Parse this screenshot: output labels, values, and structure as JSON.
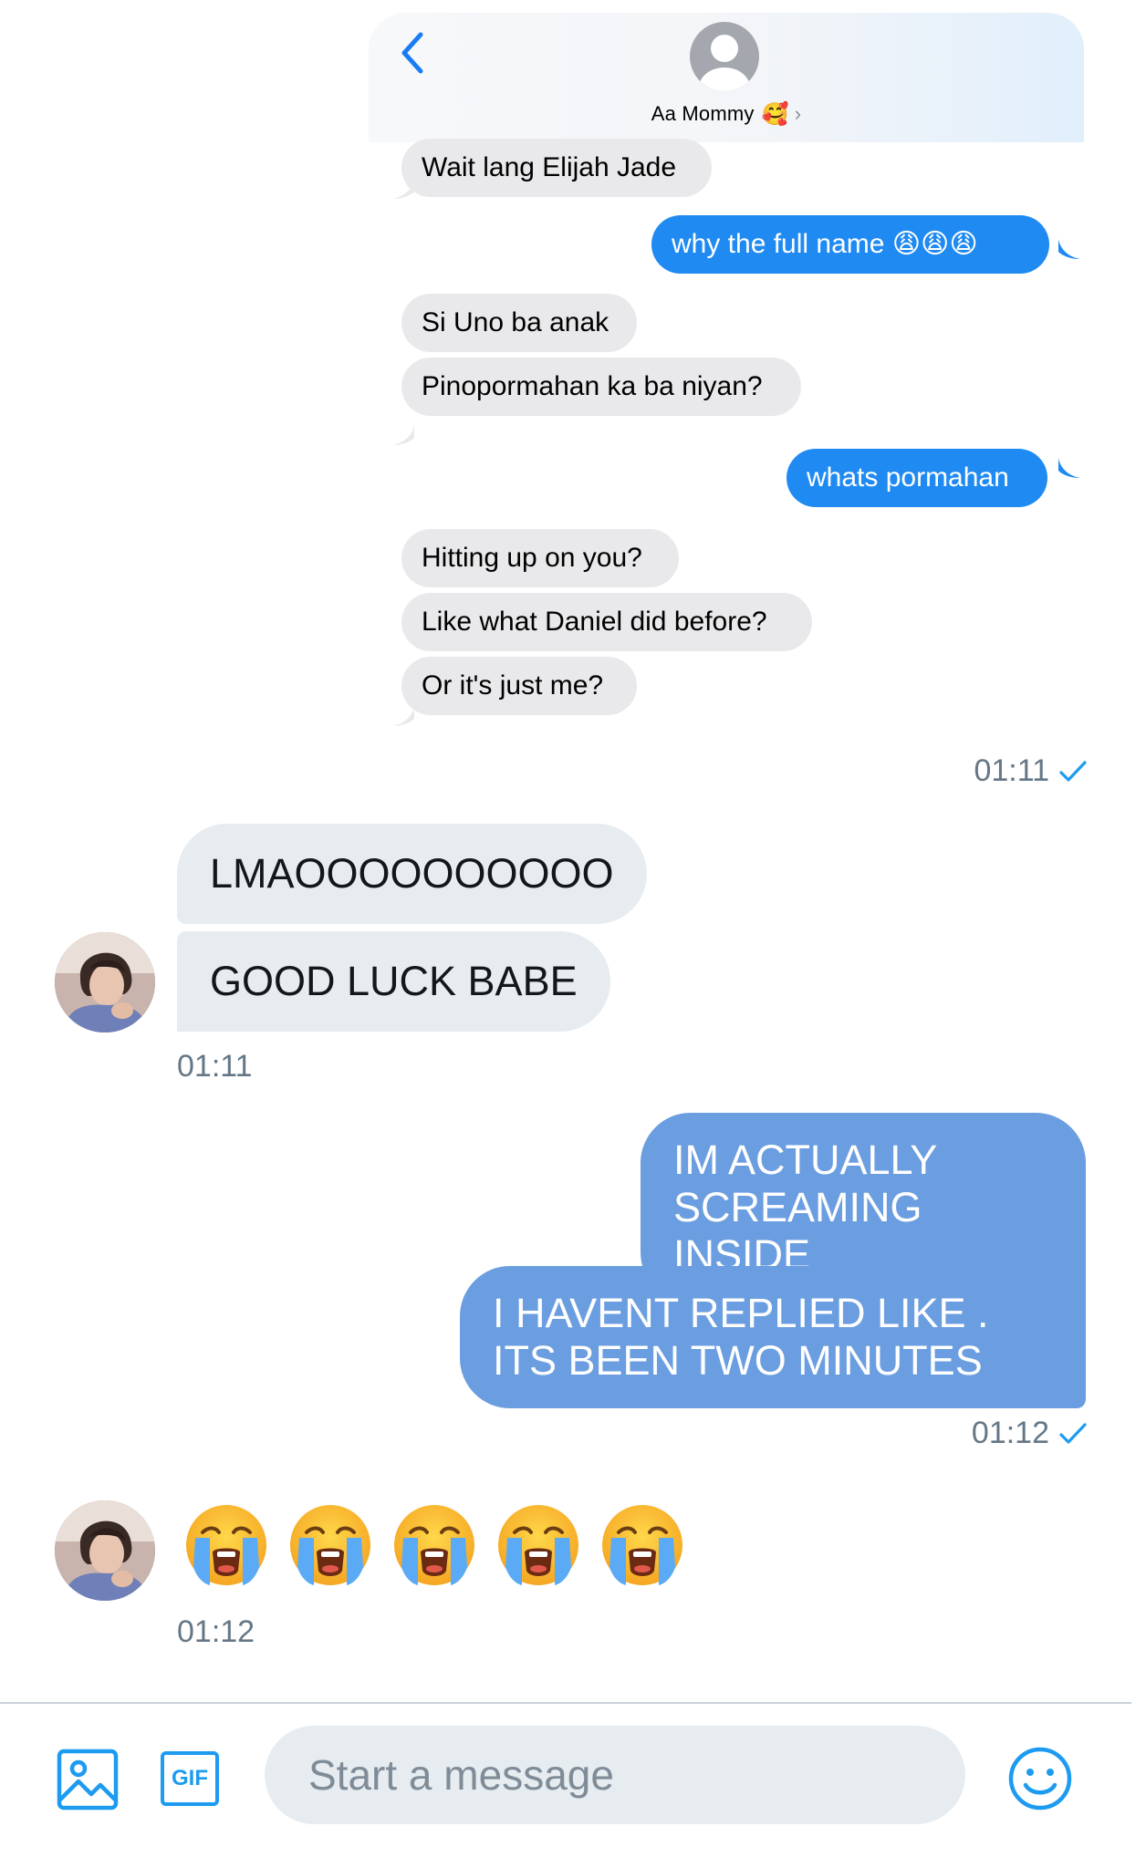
{
  "imessage": {
    "contact_name": "Aa Mommy",
    "contact_emoji": "🥰",
    "messages": [
      {
        "dir": "in",
        "text": "Wait lang Elijah Jade"
      },
      {
        "dir": "out",
        "text": "why the full name 😩😩😩"
      },
      {
        "dir": "in",
        "text": "Si Uno ba anak"
      },
      {
        "dir": "in",
        "text": "Pinopormahan ka ba niyan?"
      },
      {
        "dir": "out",
        "text": "whats pormahan"
      },
      {
        "dir": "in",
        "text": "Hitting up on you?"
      },
      {
        "dir": "in",
        "text": "Like what Daniel did before?"
      },
      {
        "dir": "in",
        "text": "Or it's just me?"
      }
    ]
  },
  "dm": {
    "timestamps": {
      "sent_1": "01:11",
      "recv_1": "01:11",
      "sent_2": "01:12",
      "recv_2": "01:12"
    },
    "received_1": [
      "LMAOOOOOOOOOO",
      "GOOD LUCK BABE"
    ],
    "sent_2": [
      "IM ACTUALLY SCREAMING INSIDE",
      "I HAVENT REPLIED LIKE . ITS BEEN TWO MINUTES"
    ],
    "received_emoji": [
      "😭",
      "😭",
      "😭",
      "😭",
      "😭"
    ]
  },
  "composer": {
    "placeholder": "Start a message",
    "gif_label": "GIF"
  },
  "colors": {
    "sent_bubble": "#6b9ee0",
    "received_bubble": "#e6ecf0",
    "accent": "#1da1f2",
    "imessage_blue": "#1f8af2"
  },
  "icons": [
    "back-chevron-icon",
    "contact-avatar-icon",
    "image-icon",
    "gif-icon",
    "emoji-icon",
    "read-check-icon"
  ]
}
